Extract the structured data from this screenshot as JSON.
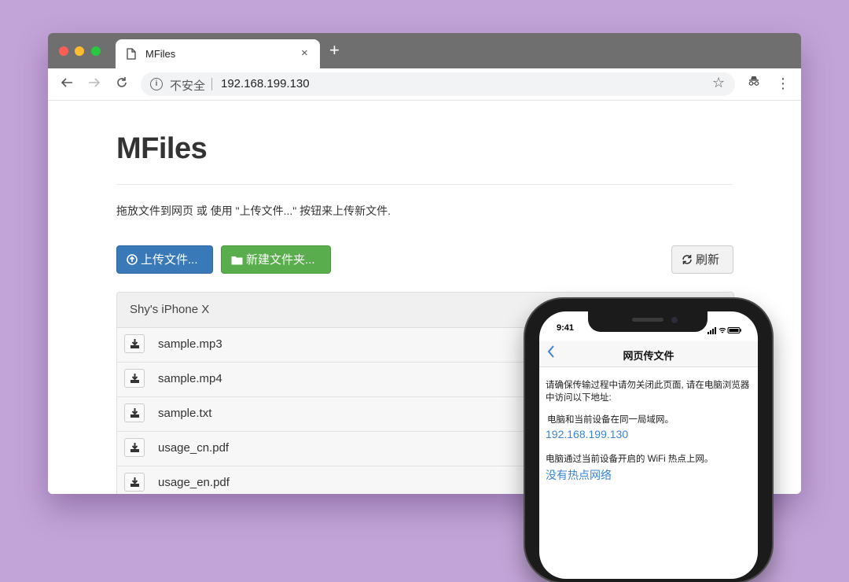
{
  "browser": {
    "tab_title": "MFiles",
    "tab_close": "×",
    "new_tab": "+",
    "insecure_label": "不安全",
    "url": "192.168.199.130"
  },
  "page": {
    "title": "MFiles",
    "instructions": "拖放文件到网页 或 使用 \"上传文件...\" 按钮来上传新文件.",
    "upload_button": "上传文件...",
    "new_folder_button": "新建文件夹...",
    "refresh_button": "刷新",
    "panel_title": "Shy's iPhone X",
    "files": [
      {
        "name": "sample.mp3"
      },
      {
        "name": "sample.mp4"
      },
      {
        "name": "sample.txt"
      },
      {
        "name": "usage_cn.pdf"
      },
      {
        "name": "usage_en.pdf"
      }
    ]
  },
  "phone": {
    "time": "9:41",
    "nav_title": "网页传文件",
    "intro": "请确保传输过程中请勿关闭此页面, 请在电脑浏览器中访问以下地址:",
    "lan_label": "电脑和当前设备在同一局域网。",
    "lan_address": "192.168.199.130",
    "hotspot_label": "电脑通过当前设备开启的 WiFi 热点上网。",
    "hotspot_status": "没有热点网络"
  },
  "colors": {
    "background": "#c3a4d8",
    "primary_button": "#3a79b8",
    "success_button": "#5aad4d",
    "ios_link": "#3a84d6"
  }
}
